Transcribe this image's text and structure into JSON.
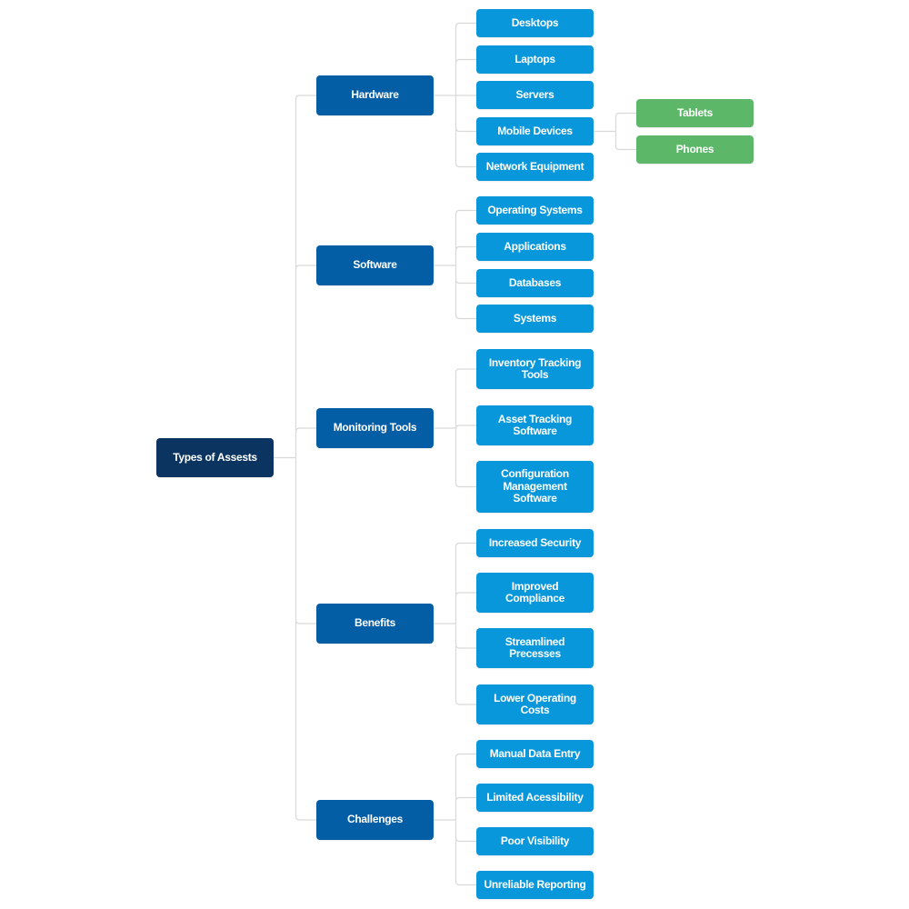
{
  "title": "Types of Assests",
  "colors": {
    "root": "#0b3460",
    "category": "#045ea5",
    "item": "#0897da",
    "subitem": "#5cb868",
    "connector": "#d9d9d9"
  },
  "root": {
    "label": "Types of Assests",
    "children": [
      {
        "label": "Hardware",
        "children": [
          {
            "label": "Desktops"
          },
          {
            "label": "Laptops"
          },
          {
            "label": "Servers"
          },
          {
            "label": "Mobile Devices",
            "children": [
              {
                "label": "Tablets"
              },
              {
                "label": "Phones"
              }
            ]
          },
          {
            "label": "Network Equipment"
          }
        ]
      },
      {
        "label": "Software",
        "children": [
          {
            "label": "Operating Systems"
          },
          {
            "label": "Applications"
          },
          {
            "label": "Databases"
          },
          {
            "label": "Systems"
          }
        ]
      },
      {
        "label": "Monitoring Tools",
        "children": [
          {
            "label": "Inventory Tracking Tools"
          },
          {
            "label": "Asset Tracking Software"
          },
          {
            "label": "Configuration Management Software"
          }
        ]
      },
      {
        "label": "Benefits",
        "children": [
          {
            "label": "Increased Security"
          },
          {
            "label": "Improved Compliance"
          },
          {
            "label": "Streamlined Precesses"
          },
          {
            "label": "Lower Operating Costs"
          }
        ]
      },
      {
        "label": "Challenges",
        "children": [
          {
            "label": "Manual Data Entry"
          },
          {
            "label": "Limited Acessibility"
          },
          {
            "label": "Poor Visibility"
          },
          {
            "label": "Unreliable Reporting"
          }
        ]
      }
    ]
  }
}
